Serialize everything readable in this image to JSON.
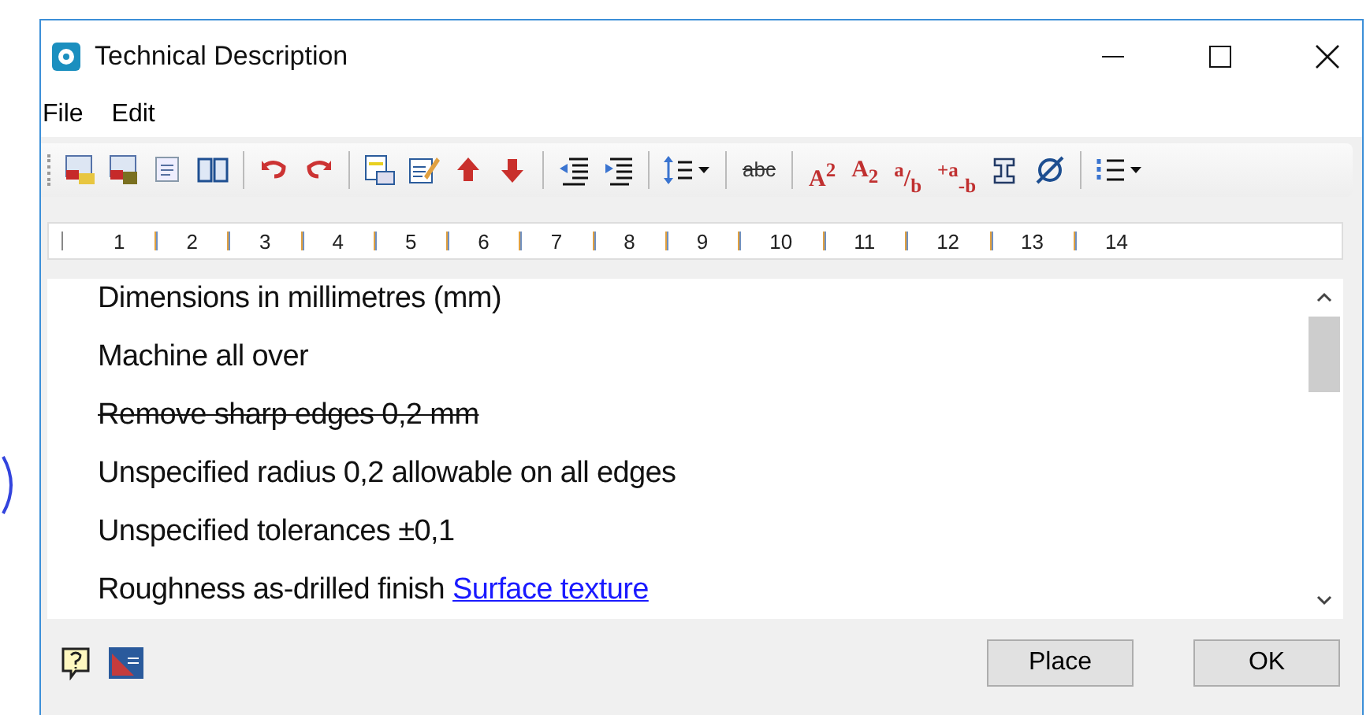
{
  "window": {
    "title": "Technical Description"
  },
  "menu": [
    "File",
    "Edit"
  ],
  "toolbar": [
    {
      "kind": "open"
    },
    {
      "kind": "save"
    },
    {
      "kind": "wordfile"
    },
    {
      "kind": "book"
    },
    {
      "kind": "sep"
    },
    {
      "kind": "undo"
    },
    {
      "kind": "redo"
    },
    {
      "kind": "sep"
    },
    {
      "kind": "insert"
    },
    {
      "kind": "edit"
    },
    {
      "kind": "up"
    },
    {
      "kind": "down"
    },
    {
      "kind": "sep"
    },
    {
      "kind": "outdent"
    },
    {
      "kind": "indent"
    },
    {
      "kind": "sep"
    },
    {
      "kind": "spacing"
    },
    {
      "kind": "sep"
    },
    {
      "kind": "glyph",
      "text": "abc",
      "strike": true
    },
    {
      "kind": "sep"
    },
    {
      "kind": "glyph",
      "text": "A$^{2}$",
      "strike": false
    },
    {
      "kind": "glyph",
      "text": "A$_{2}$",
      "strike": false
    },
    {
      "kind": "glyph",
      "text": "$^{a}$/$_{b}$",
      "strike": false
    },
    {
      "kind": "glyph",
      "text": "$^{+a}$$_{-b}$",
      "strike": false
    },
    {
      "kind": "profile"
    },
    {
      "kind": "diameter"
    },
    {
      "kind": "sep"
    },
    {
      "kind": "list"
    }
  ],
  "ruler": [
    "1",
    "2",
    "3",
    "4",
    "5",
    "6",
    "7",
    "8",
    "9",
    "10",
    "11",
    "12",
    "13",
    "14"
  ],
  "lines": [
    {
      "text": "Dimensions in millimetres (mm)",
      "struck": false
    },
    {
      "text": "Machine all over",
      "struck": false
    },
    {
      "text": "Remove sharp edges 0,2 mm",
      "struck": true
    },
    {
      "text": "Unspecified radius 0,2 allowable on all edges",
      "struck": false
    },
    {
      "text": "Unspecified tolerances ±0,1",
      "struck": false
    },
    {
      "text": "Roughness as-drilled finish",
      "struck": false,
      "link": "Surface texture"
    }
  ],
  "buttons": [
    "Place",
    "OK"
  ]
}
